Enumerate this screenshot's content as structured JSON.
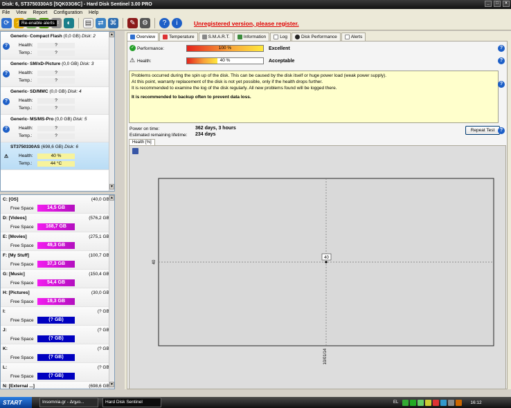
{
  "window": {
    "title": "Disk: 6, ST3750330AS [5QK03G6C]  -  Hard Disk Sentinel 3.00 PRO"
  },
  "menu": [
    "File",
    "View",
    "Report",
    "Configuration",
    "Help"
  ],
  "toolbar": {
    "unregistered": "Unregistered version, please register.",
    "tooltip": "Re-enable alerts"
  },
  "disks": [
    {
      "name": "Generic- Compact Flash",
      "size": "(0,0 GB)",
      "disk": "Disk: 2",
      "health": "?",
      "temp": "?",
      "state": "unknown"
    },
    {
      "name": "Generic- SM/xD-Picture",
      "size": "(0,0 GB)",
      "disk": "Disk: 3",
      "health": "?",
      "temp": "?",
      "state": "unknown"
    },
    {
      "name": "Generic- SD/MMC",
      "size": "(0,0 GB)",
      "disk": "Disk: 4",
      "health": "?",
      "temp": "?",
      "state": "unknown"
    },
    {
      "name": "Generic- MS/MS-Pro",
      "size": "(0,0 GB)",
      "disk": "Disk: 5",
      "health": "?",
      "temp": "?",
      "state": "unknown"
    },
    {
      "name": "ST3750330AS",
      "size": "(698,6 GB)",
      "disk": "Disk: 6",
      "health": "40 %",
      "temp": "44 °C",
      "state": "warning"
    }
  ],
  "labels": {
    "health": "Health:",
    "temp": "Temp.:",
    "free_space": "Free Space",
    "performance": "Performance:",
    "health_main": "Health:",
    "power_on": "Power on time:",
    "remaining": "Estimated remaining lifetime:"
  },
  "volumes": [
    {
      "name": "C: [OS]",
      "size": "(40,0 GB)",
      "free": "14,5 GB",
      "style": "mag"
    },
    {
      "name": "D: [Videos]",
      "size": "(576,2 GB)",
      "free": "168,7 GB",
      "style": "mag"
    },
    {
      "name": "E: [Movies]",
      "size": "(275,1 GB)",
      "free": "49,3 GB",
      "style": "mag"
    },
    {
      "name": "F: [My Stuff]",
      "size": "(100,7 GB)",
      "free": "37,3 GB",
      "style": "mag"
    },
    {
      "name": "G: [Music]",
      "size": "(150,4 GB)",
      "free": "54,4 GB",
      "style": "mag"
    },
    {
      "name": "H: [Pictures]",
      "size": "(30,0 GB)",
      "free": "19,3 GB",
      "style": "mag"
    },
    {
      "name": "I:",
      "size": "(? GB)",
      "free": "(? GB)",
      "style": "blue"
    },
    {
      "name": "J:",
      "size": "(? GB)",
      "free": "(? GB)",
      "style": "blue"
    },
    {
      "name": "K:",
      "size": "(? GB)",
      "free": "(? GB)",
      "style": "blue"
    },
    {
      "name": "L:",
      "size": "(? GB)",
      "free": "(? GB)",
      "style": "blue"
    },
    {
      "name": "N: [External ...]",
      "size": "(698,6 GB)",
      "free": "",
      "style": "blue"
    }
  ],
  "tabs": [
    "Overview",
    "Temperature",
    "S.M.A.R.T.",
    "Information",
    "Log",
    "Disk Performance",
    "Alerts"
  ],
  "overview": {
    "performance_value": "100 %",
    "performance_pct": 100,
    "performance_word": "Excellent",
    "health_value": "40 %",
    "health_pct": 40,
    "health_word": "Acceptable",
    "message_lines": [
      "Problems occurred during the spin up of the disk. This can be caused by the disk itself or huge power load (weak power supply).",
      "At this point, warranty replacement of the disk is not yet possible, only if the health drops further.",
      "It is recommended to examine the log of the disk regularly. All new problems found will be logged there."
    ],
    "message_bold": "It is recommended to backup often to prevent data loss.",
    "power_on_value": "362 days, 3 hours",
    "remaining_value": "234 days",
    "repeat_button": "Repeat Test",
    "chart_tab": "Health [%]"
  },
  "chart_data": {
    "type": "scatter",
    "title": "",
    "x": [
      "10/01/14"
    ],
    "values": [
      40
    ],
    "point_label": "40",
    "y_tick": "40",
    "x_tick": "10/01/14"
  },
  "taskbar": {
    "start": "START",
    "tasks": [
      "Insomnia.gr - Δημο...",
      "Hard Disk Sentinel"
    ],
    "lang": "EL",
    "clock": "16:12"
  },
  "colors": {
    "accent_red": "#e00000",
    "help_blue": "#1d5fc7",
    "free_space_magenta": "#d414d8",
    "free_space_blue": "#0000c0",
    "warning_yellow": "#f7f39c",
    "message_yellow": "#ffffcc"
  }
}
